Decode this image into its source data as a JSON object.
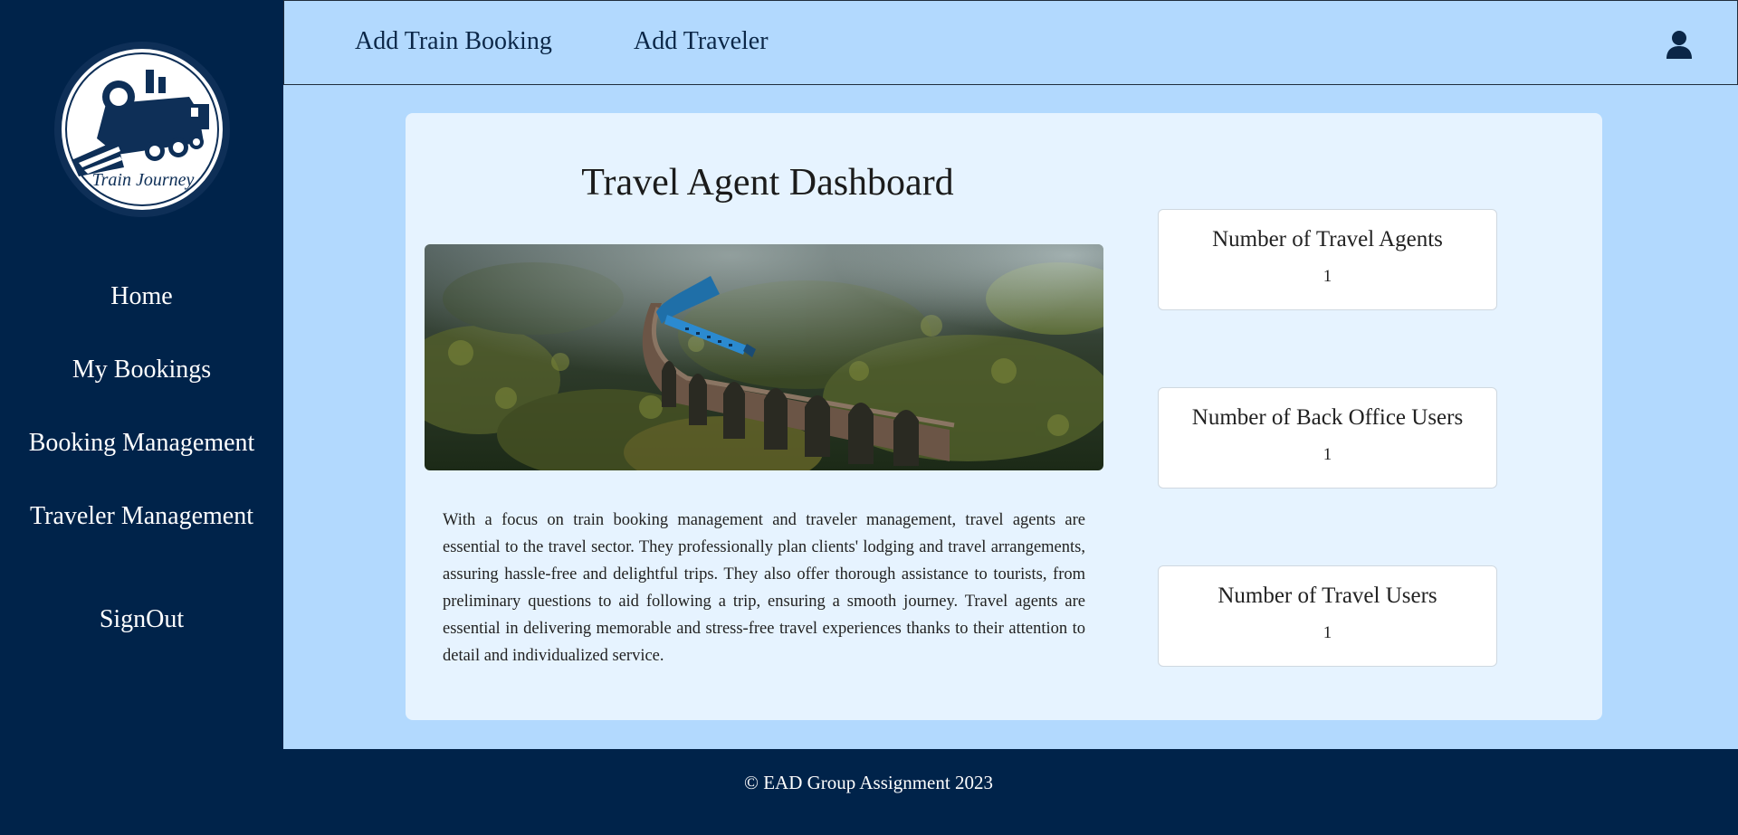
{
  "brand": {
    "logo_text": "Train Journey"
  },
  "sidebar": {
    "items": [
      {
        "label": "Home"
      },
      {
        "label": "My Bookings"
      },
      {
        "label": "Booking Management"
      },
      {
        "label": "Traveler Management"
      },
      {
        "label": "SignOut"
      }
    ]
  },
  "topbar": {
    "links": [
      {
        "label": "Add Train Booking"
      },
      {
        "label": "Add Traveler"
      }
    ],
    "user_icon": "user-icon"
  },
  "main": {
    "title": "Travel Agent Dashboard",
    "description": "With a focus on train booking management and traveler management, travel agents are essential to the travel sector. They professionally plan clients' lodging and travel arrangements, assuring hassle-free and delightful trips. They also offer thorough assistance to tourists, from preliminary questions to aid following a trip, ensuring a smooth journey. Travel agents are essential in delivering memorable and stress-free travel experiences thanks to their attention to detail and individualized service.",
    "stats": [
      {
        "label": "Number of Travel Agents",
        "value": "1"
      },
      {
        "label": "Number of Back Office Users",
        "value": "1"
      },
      {
        "label": "Number of Travel Users",
        "value": "1"
      }
    ]
  },
  "footer": {
    "text": "© EAD Group Assignment 2023"
  },
  "colors": {
    "sidebar": "#00234a",
    "page_bg": "#b2d9fe",
    "card_bg": "#e6f3ff"
  }
}
